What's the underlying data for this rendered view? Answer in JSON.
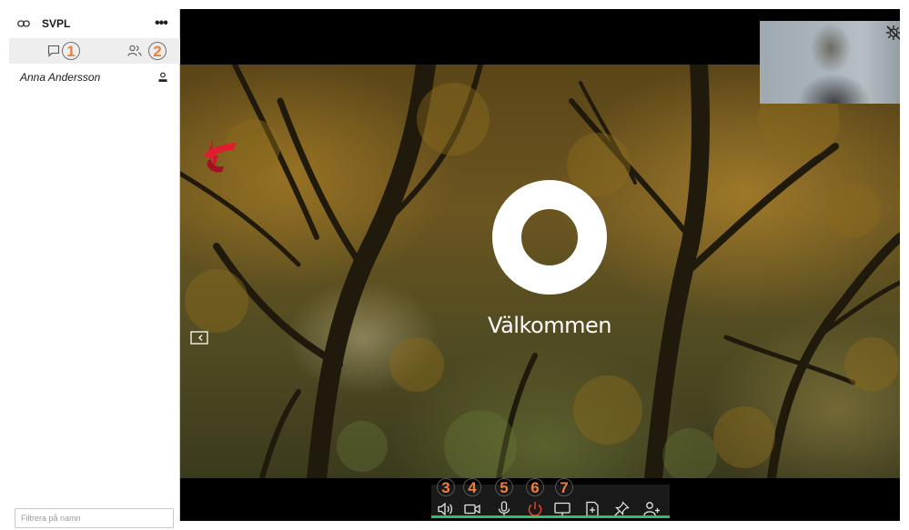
{
  "sidebar": {
    "title": "SVPL",
    "more_label": "•••",
    "tabs": [
      {
        "name": "chat",
        "icon": "chat-bubble-icon",
        "badge": "1"
      },
      {
        "name": "participants",
        "icon": "people-icon",
        "badge": "2"
      }
    ],
    "participants": [
      {
        "name": "Anna Andersson",
        "icon": "person-icon"
      }
    ],
    "filter": {
      "placeholder": "Filtrera på namn",
      "value": ""
    }
  },
  "main": {
    "welcome_text": "Välkommen",
    "self_view": {
      "icon": "camera-off-icon"
    }
  },
  "toolbar": {
    "buttons": [
      {
        "icon": "speaker-icon",
        "number": "3"
      },
      {
        "icon": "video-camera-icon",
        "number": "4"
      },
      {
        "icon": "microphone-icon",
        "number": "5"
      },
      {
        "icon": "power-hangup-icon",
        "number": "6",
        "color": "#e8452c"
      },
      {
        "icon": "screen-share-icon",
        "number": "7"
      },
      {
        "icon": "add-content-icon",
        "number": ""
      },
      {
        "icon": "pin-icon",
        "number": ""
      },
      {
        "icon": "add-person-icon",
        "number": ""
      }
    ],
    "accent_color": "#2fbf71"
  },
  "colors": {
    "annotation": "#ee7f3f",
    "logo": "#e21b2e"
  }
}
